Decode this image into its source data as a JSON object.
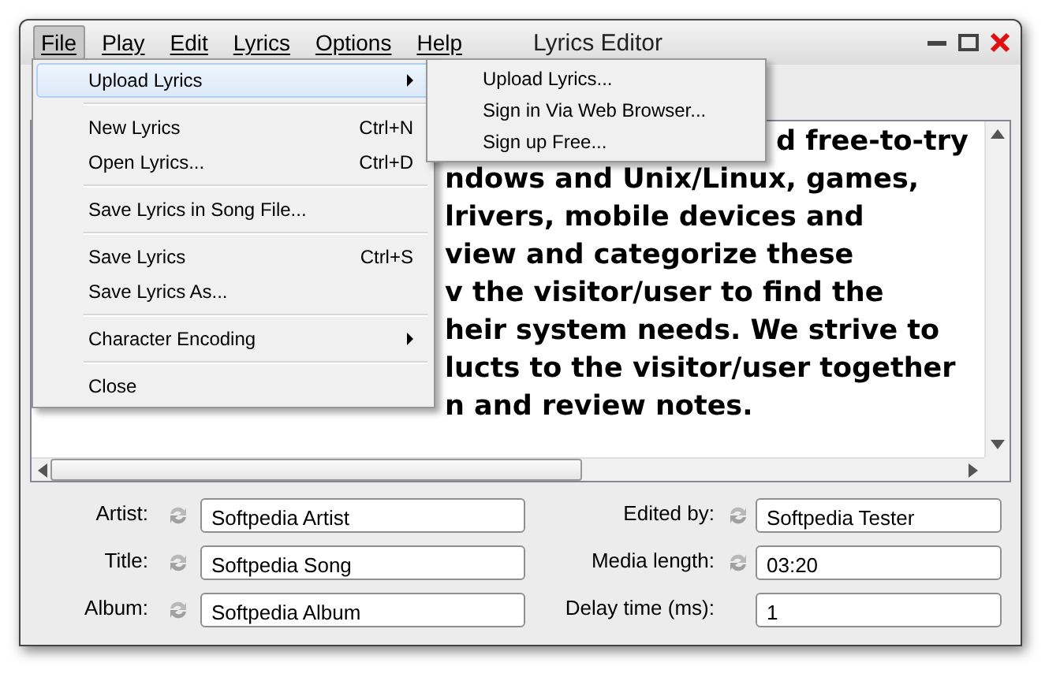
{
  "window": {
    "title": "Lyrics Editor"
  },
  "menubar": [
    {
      "label": "File",
      "selected": true
    },
    {
      "label": "Play",
      "selected": false
    },
    {
      "label": "Edit",
      "selected": false
    },
    {
      "label": "Lyrics",
      "selected": false
    },
    {
      "label": "Options",
      "selected": false
    },
    {
      "label": "Help",
      "selected": false
    }
  ],
  "file_menu": [
    {
      "kind": "item",
      "label": "Upload Lyrics",
      "selected": true,
      "submenu": true
    },
    {
      "kind": "separator"
    },
    {
      "kind": "item",
      "label": "New Lyrics",
      "shortcut": "Ctrl+N",
      "selected": false,
      "submenu": false
    },
    {
      "kind": "item",
      "label": "Open Lyrics...",
      "shortcut": "Ctrl+D",
      "selected": false,
      "submenu": false
    },
    {
      "kind": "separator"
    },
    {
      "kind": "item",
      "label": "Save Lyrics in Song File...",
      "selected": false,
      "submenu": false
    },
    {
      "kind": "separator"
    },
    {
      "kind": "item",
      "label": "Save Lyrics",
      "shortcut": "Ctrl+S",
      "selected": false,
      "submenu": false
    },
    {
      "kind": "item",
      "label": "Save Lyrics As...",
      "selected": false,
      "submenu": false
    },
    {
      "kind": "separator"
    },
    {
      "kind": "item",
      "label": "Character Encoding",
      "selected": false,
      "submenu": true
    },
    {
      "kind": "separator"
    },
    {
      "kind": "item",
      "label": "Close",
      "selected": false,
      "submenu": false
    }
  ],
  "upload_submenu": [
    {
      "kind": "item",
      "label": "Upload Lyrics...",
      "selected": false,
      "submenu": false
    },
    {
      "kind": "item",
      "label": "Sign in Via Web Browser...",
      "selected": false,
      "submenu": false
    },
    {
      "kind": "item",
      "label": "Sign up Free...",
      "selected": false,
      "submenu": false
    }
  ],
  "lyrics": {
    "lines": [
      "d free-to-try",
      "ndows and Unix/Linux, games,",
      "lrivers, mobile devices and",
      "view and categorize these",
      "v the visitor/user to find the",
      "heir system needs. We strive to",
      "lucts to the visitor/user together",
      "n and review notes."
    ]
  },
  "fields": [
    {
      "label": "Artist:",
      "value": "Softpedia Artist",
      "sync": true
    },
    {
      "label": "Edited by:",
      "value": "Softpedia Tester",
      "sync": true
    },
    {
      "label": "Title:",
      "value": "Softpedia Song",
      "sync": true
    },
    {
      "label": "Media length:",
      "value": "03:20",
      "sync": true
    },
    {
      "label": "Album:",
      "value": "Softpedia Album",
      "sync": true
    },
    {
      "label": "Delay time (ms):",
      "value": "1",
      "sync": false
    }
  ]
}
